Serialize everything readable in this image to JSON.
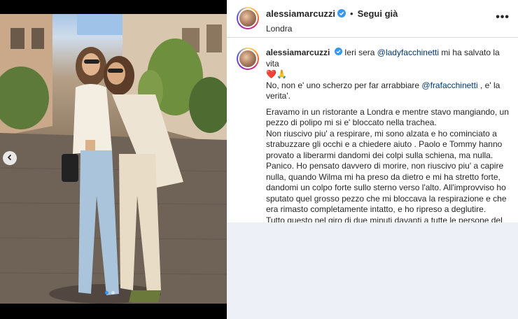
{
  "post": {
    "username": "alessiamarcuzzi",
    "follow_label": "Segui già",
    "separator": "•",
    "location": "Londra",
    "more_label": "•••"
  },
  "caption": {
    "username": "alessiamarcuzzi",
    "lead_text": "Ieri sera ",
    "mention1": "@ladyfacchinetti",
    "lead_text_after": " mi ha salvato la vita",
    "emojis": "❤️🙏",
    "line2_pre": "No, non e' uno scherzo per far arrabbiare ",
    "mention2": "@frafacchinetti",
    "line2_post": " , e' la verita'.",
    "paragraph": "Eravamo in un ristorante a Londra e mentre stavo mangiando, un pezzo di polipo mi si e' bloccato nella trachea.",
    "lines": [
      "Non riuscivo piu' a respirare, mi sono alzata e ho cominciato a strabuzzare gli occhi e a chiedere aiuto . Paolo e Tommy hanno provato a liberarmi dandomi dei colpi sulla schiena, ma nulla.",
      "Panico. Ho pensato davvero di morire, non riuscivo piu' a capire nulla, quando Wilma mi ha preso da dietro e mi ha stretto forte, dandomi un colpo forte sullo sterno verso l'alto. All'improvviso ho sputato quel grosso pezzo che mi bloccava la respirazione e che era rimasto completamente intatto, e ho ripreso a deglutire.",
      "Tutto questo nel giro di due minuti davanti a tutte le persone del ristorante che non capivano che cosa stesse succedendo."
    ]
  },
  "carousel": {
    "total_slides": 2,
    "active_slide": 1
  },
  "colors": {
    "verified": "#3897f0",
    "mention": "#00376b",
    "lower_bg": "#eef0f8"
  },
  "icons": {
    "verified": "verified-badge-icon",
    "prev": "chevron-left-icon",
    "more": "more-options-icon"
  }
}
